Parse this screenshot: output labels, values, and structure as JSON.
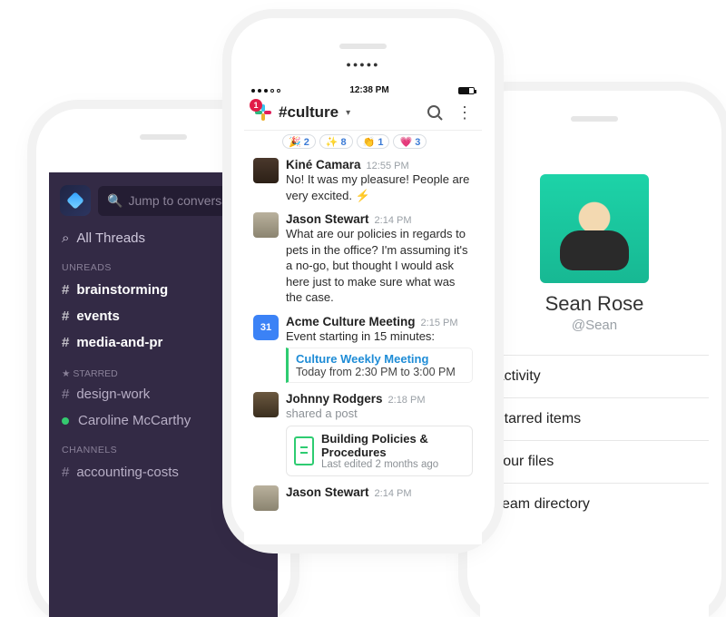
{
  "status": {
    "time": "12:38 PM"
  },
  "sidebar": {
    "jump_placeholder": "Jump to conversation",
    "all_threads": "All Threads",
    "labels": {
      "unreads": "UNREADS",
      "starred": "STARRED",
      "channels": "CHANNELS"
    },
    "unreads": [
      {
        "name": "brainstorming"
      },
      {
        "name": "events"
      },
      {
        "name": "media-and-pr"
      }
    ],
    "starred": [
      {
        "name": "design-work",
        "type": "channel"
      },
      {
        "name": "Caroline McCarthy",
        "type": "dm"
      }
    ],
    "channels": [
      {
        "name": "accounting-costs"
      }
    ]
  },
  "channel": {
    "name": "#culture",
    "badge": "1",
    "reactions": [
      {
        "emoji": "🎉",
        "count": "2"
      },
      {
        "emoji": "✨",
        "count": "8"
      },
      {
        "emoji": "👏",
        "count": "1"
      },
      {
        "emoji": "💗",
        "count": "3"
      }
    ],
    "messages": [
      {
        "id": "m1",
        "user": "Kiné Camara",
        "time": "12:55 PM",
        "body": "No! It was my pleasure! People are very excited. ⚡"
      },
      {
        "id": "m2",
        "user": "Jason Stewart",
        "time": "2:14 PM",
        "body": "What are our policies in regards to pets in the office? I'm assuming it's a no-go, but thought I would ask here just to make sure what was the case."
      },
      {
        "id": "m3",
        "user": "Acme Culture Meeting",
        "time": "2:15 PM",
        "subtitle": "Event starting in 15 minutes:",
        "attachment": {
          "title": "Culture Weekly Meeting",
          "detail": "Today from 2:30 PM to 3:00 PM"
        }
      },
      {
        "id": "m4",
        "user": "Johnny Rodgers",
        "time": "2:18 PM",
        "subtitle": "shared a post",
        "doc": {
          "title": "Building Policies & Procedures",
          "meta": "Last edited 2 months ago"
        }
      },
      {
        "id": "m5",
        "user": "Jason Stewart",
        "time": "2:14 PM",
        "body": ""
      }
    ]
  },
  "profile": {
    "name": "Sean Rose",
    "handle": "@Sean",
    "menu": [
      "Activity",
      "Starred items",
      "Your files",
      "Team directory"
    ]
  },
  "cal_label": "31"
}
